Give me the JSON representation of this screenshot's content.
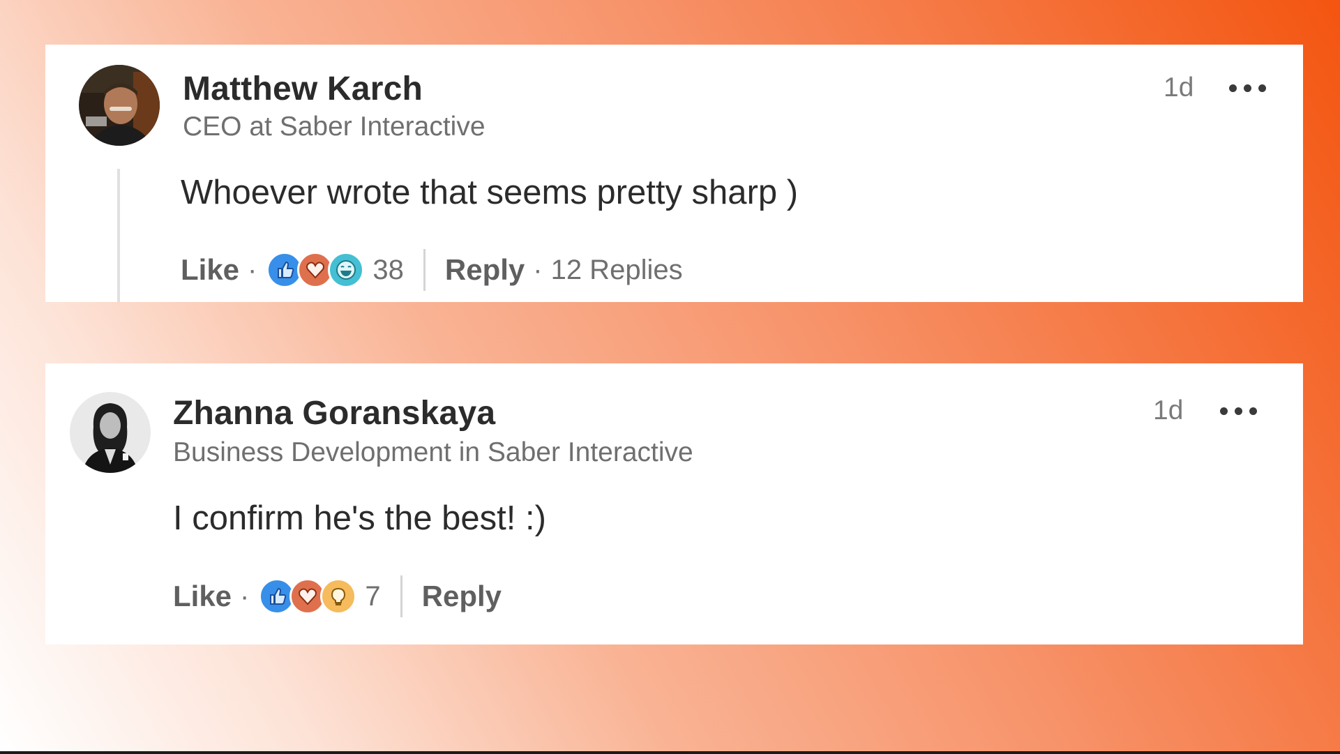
{
  "comments": [
    {
      "author": "Matthew Karch",
      "headline": "CEO at Saber Interactive",
      "time": "1d",
      "text": "Whoever wrote that seems pretty sharp )",
      "like_label": "Like",
      "reaction_icons": [
        "like-icon",
        "love-icon",
        "funny-icon"
      ],
      "reaction_count": "38",
      "reply_label": "Reply",
      "replies_label": "12 Replies"
    },
    {
      "author": "Zhanna Goranskaya",
      "headline": "Business Development in Saber Interactive",
      "time": "1d",
      "text": "I confirm he's the best! :)",
      "like_label": "Like",
      "reaction_icons": [
        "like-icon",
        "love-icon",
        "insightful-icon"
      ],
      "reaction_count": "7",
      "reply_label": "Reply"
    }
  ],
  "colors": {
    "like": "#378fe9",
    "love": "#df704d",
    "funny": "#44bfd3",
    "insightful": "#f5bb5c"
  }
}
